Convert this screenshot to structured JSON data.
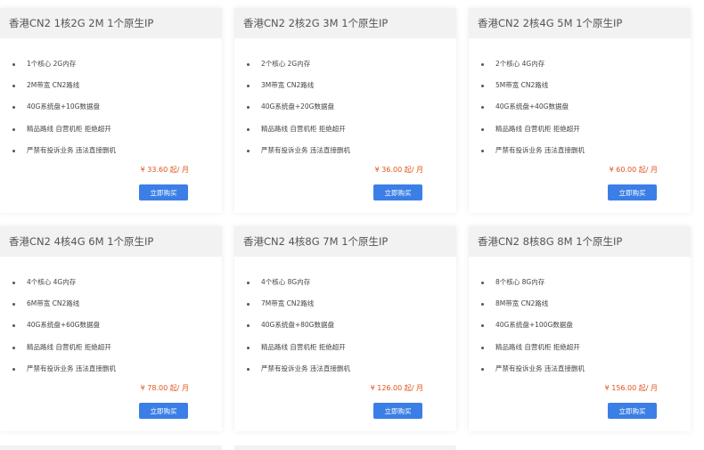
{
  "colors": {
    "header_bg": "#f2f2f2",
    "price": "#e0531b",
    "button": "#3b7fe6"
  },
  "plans": [
    {
      "title": "香港CN2 1核2G 2M 1个原生IP",
      "features": [
        "1个核心 2G内存",
        "2M带宽 CN2路线",
        "40G系统盘+10G数据盘",
        "精品路线 自营机柜 拒绝超开",
        "严禁有投诉业务 违法直接删机"
      ],
      "price": "¥ 33.60 起/ 月",
      "button": "立即购买"
    },
    {
      "title": "香港CN2 2核2G 3M 1个原生IP",
      "features": [
        "2个核心 2G内存",
        "3M带宽 CN2路线",
        "40G系统盘+20G数据盘",
        "精品路线 自营机柜 拒绝超开",
        "严禁有投诉业务 违法直接删机"
      ],
      "price": "¥ 36.00 起/ 月",
      "button": "立即购买"
    },
    {
      "title": "香港CN2 2核4G 5M 1个原生IP",
      "features": [
        "2个核心 4G内存",
        "5M带宽 CN2路线",
        "40G系统盘+40G数据盘",
        "精品路线 自营机柜 拒绝超开",
        "严禁有投诉业务 违法直接删机"
      ],
      "price": "¥ 60.00 起/ 月",
      "button": "立即购买"
    },
    {
      "title": "香港CN2 4核4G 6M 1个原生IP",
      "features": [
        "4个核心 4G内存",
        "6M带宽 CN2路线",
        "40G系统盘+60G数据盘",
        "精品路线 自营机柜 拒绝超开",
        "严禁有投诉业务 违法直接删机"
      ],
      "price": "¥ 78.00 起/ 月",
      "button": "立即购买"
    },
    {
      "title": "香港CN2 4核8G 7M 1个原生IP",
      "features": [
        "4个核心 8G内存",
        "7M带宽 CN2路线",
        "40G系统盘+80G数据盘",
        "精品路线 自营机柜 拒绝超开",
        "严禁有投诉业务 违法直接删机"
      ],
      "price": "¥ 126.00 起/ 月",
      "button": "立即购买"
    },
    {
      "title": "香港CN2 8核8G 8M 1个原生IP",
      "features": [
        "8个核心 8G内存",
        "8M带宽 CN2路线",
        "40G系统盘+100G数据盘",
        "精品路线 自营机柜 拒绝超开",
        "严禁有投诉业务 违法直接删机"
      ],
      "price": "¥ 156.00 起/ 月",
      "button": "立即购买"
    }
  ]
}
